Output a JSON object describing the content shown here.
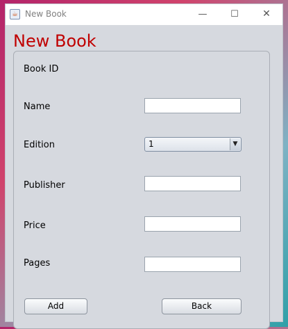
{
  "window": {
    "title": "New Book",
    "icon": "java-coffee-icon",
    "controls": {
      "minimize": "—",
      "maximize": "☐",
      "close": "✕"
    }
  },
  "form": {
    "heading": "New Book",
    "heading_color": "#c00000",
    "fields": {
      "book_id": {
        "label": "Book ID"
      },
      "name": {
        "label": "Name",
        "value": ""
      },
      "edition": {
        "label": "Edition",
        "value": "1"
      },
      "publisher": {
        "label": "Publisher",
        "value": ""
      },
      "price": {
        "label": "Price",
        "value": ""
      },
      "pages": {
        "label": "Pages",
        "value": ""
      }
    },
    "buttons": {
      "add": "Add",
      "back": "Back"
    }
  }
}
